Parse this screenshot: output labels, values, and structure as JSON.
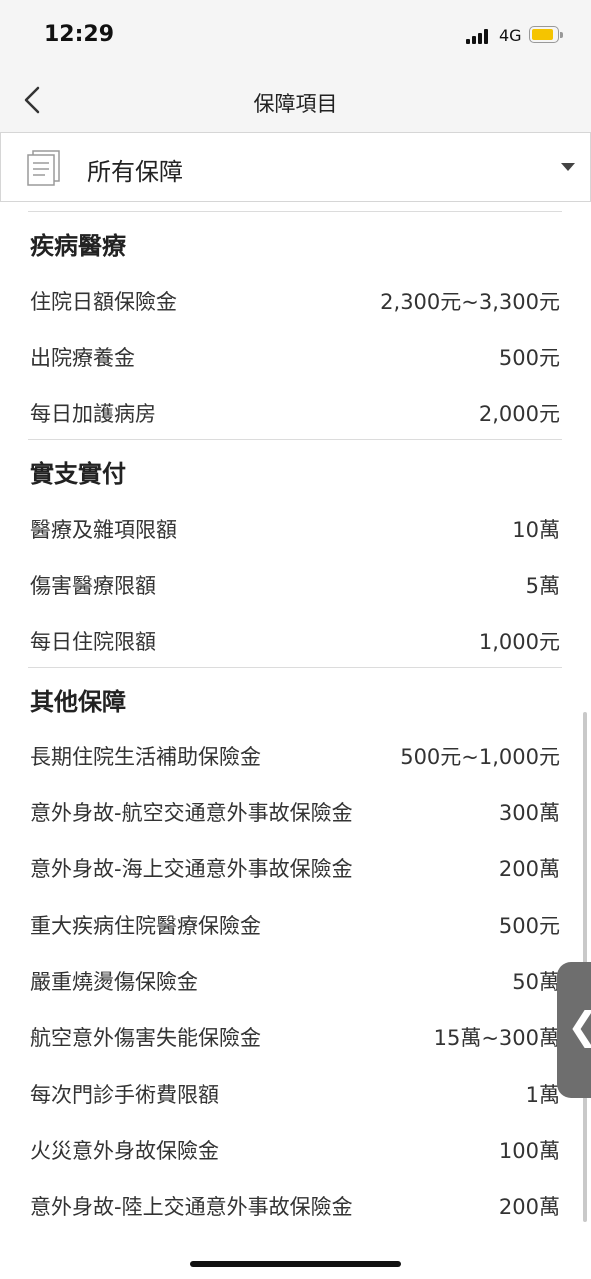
{
  "status_bar": {
    "time": "12:29",
    "network": "4G",
    "battery_color": "#f5c400"
  },
  "nav": {
    "title": "保障項目",
    "back_icon": "chevron-left-icon"
  },
  "filter": {
    "label": "所有保障",
    "icon": "document-icon",
    "dropdown_icon": "caret-down-icon"
  },
  "sections": [
    {
      "title": "疾病醫療",
      "items": [
        {
          "name": "住院日額保險金",
          "value": "2,300元~3,300元"
        },
        {
          "name": "出院療養金",
          "value": "500元"
        },
        {
          "name": "每日加護病房",
          "value": "2,000元"
        }
      ]
    },
    {
      "title": "實支實付",
      "items": [
        {
          "name": "醫療及雜項限額",
          "value": "10萬"
        },
        {
          "name": "傷害醫療限額",
          "value": "5萬"
        },
        {
          "name": "每日住院限額",
          "value": "1,000元"
        }
      ]
    },
    {
      "title": "其他保障",
      "items": [
        {
          "name": "長期住院生活補助保險金",
          "value": "500元~1,000元"
        },
        {
          "name": "意外身故-航空交通意外事故保險金",
          "value": "300萬"
        },
        {
          "name": "意外身故-海上交通意外事故保險金",
          "value": "200萬"
        },
        {
          "name": "重大疾病住院醫療保險金",
          "value": "500元"
        },
        {
          "name": "嚴重燒燙傷保險金",
          "value": "50萬"
        },
        {
          "name": "航空意外傷害失能保險金",
          "value": "15萬~300萬"
        },
        {
          "name": "每次門診手術費限額",
          "value": "1萬"
        },
        {
          "name": "火災意外身故保險金",
          "value": "100萬"
        },
        {
          "name": "意外身故-陸上交通意外事故保險金",
          "value": "200萬"
        }
      ]
    }
  ],
  "side_handle": {
    "glyph": "❮"
  }
}
